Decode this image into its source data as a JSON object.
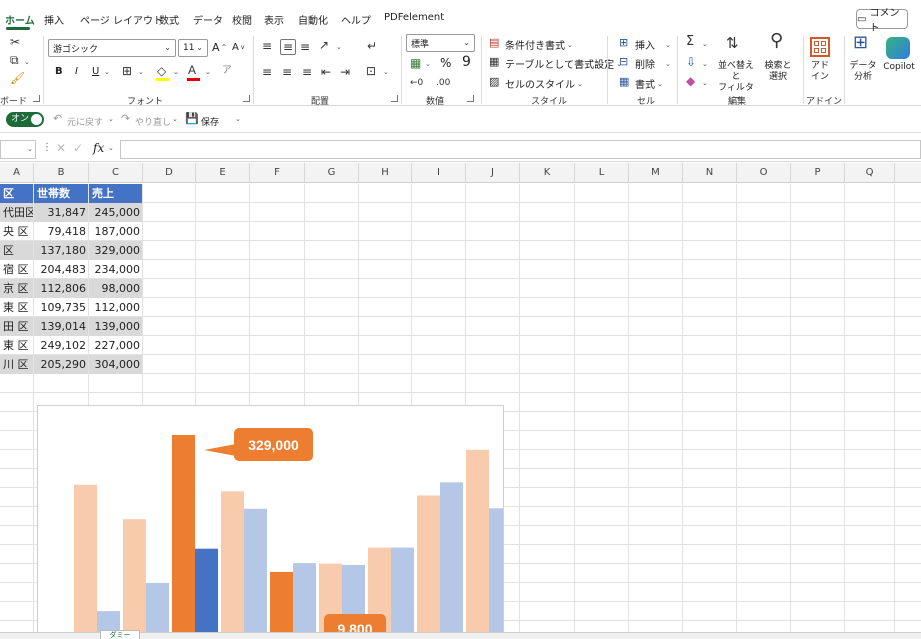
{
  "menu": {
    "tabs": [
      "ホーム",
      "挿入",
      "ページ レイアウト",
      "数式",
      "データ",
      "校閲",
      "表示",
      "自動化",
      "ヘルプ",
      "PDFelement"
    ],
    "comment_label": "コメント"
  },
  "ribbon": {
    "clipboard_label": "ボード",
    "font_name": "游ゴシック",
    "font_size": "11",
    "font_grow": "A",
    "font_shrink": "A",
    "bold": "B",
    "italic": "I",
    "underline": "U",
    "font_label": "フォント",
    "align_label": "配置",
    "number_format": "標準",
    "percent": "%",
    "comma": "9",
    "number_label": "数値",
    "cond_format": "条件付き書式",
    "table_format": "テーブルとして書式設定",
    "cell_style": "セルのスタイル",
    "style_label": "スタイル",
    "insert": "挿入",
    "delete": "削除",
    "format": "書式",
    "cells_label": "セル",
    "sort_filter": "並べ替えと\nフィルター",
    "find_select": "検索と\n選択",
    "edit_label": "編集",
    "addin": "アド\nイン",
    "addin_label": "アドイン",
    "data_analysis": "データ\n分析",
    "copilot": "Copilot"
  },
  "qat": {
    "autosave": "オン",
    "undo": "元に戻す",
    "redo": "やり直し",
    "save": "保存"
  },
  "formula": {
    "fx": "fx"
  },
  "columns": [
    "A",
    "B",
    "C",
    "D",
    "E",
    "F",
    "G",
    "H",
    "I",
    "J",
    "K",
    "L",
    "M",
    "N",
    "O",
    "P",
    "Q"
  ],
  "table": {
    "headers": [
      "区",
      "世帯数",
      "売上"
    ],
    "rows": [
      [
        "代田区",
        "31,847",
        "245,000"
      ],
      [
        "央 区",
        "79,418",
        "187,000"
      ],
      [
        "区",
        "137,180",
        "329,000"
      ],
      [
        "宿 区",
        "204,483",
        "234,000"
      ],
      [
        "京 区",
        "112,806",
        "98,000"
      ],
      [
        "東 区",
        "109,735",
        "112,000"
      ],
      [
        "田 区",
        "139,014",
        "139,000"
      ],
      [
        "東 区",
        "249,102",
        "227,000"
      ],
      [
        "川 区",
        "205,290",
        "304,000"
      ]
    ]
  },
  "chart_data": {
    "type": "bar",
    "series": [
      {
        "values": [
          245000,
          187000,
          329000,
          234000,
          98000,
          112000,
          139000,
          227000,
          304000
        ]
      },
      {
        "values": [
          31847,
          79418,
          137180,
          204483,
          112806,
          109735,
          139014,
          249102,
          205290
        ]
      }
    ],
    "highlight": {
      "max_index": 2,
      "min_index": 4
    },
    "callouts": [
      "329,000",
      "9,800"
    ],
    "colors": {
      "highlight": "#ed7d31",
      "light": "#f8cbad",
      "blue": "#4472c4",
      "light_blue": "#b4c7e7"
    }
  },
  "sheet_tab": "ダミー"
}
